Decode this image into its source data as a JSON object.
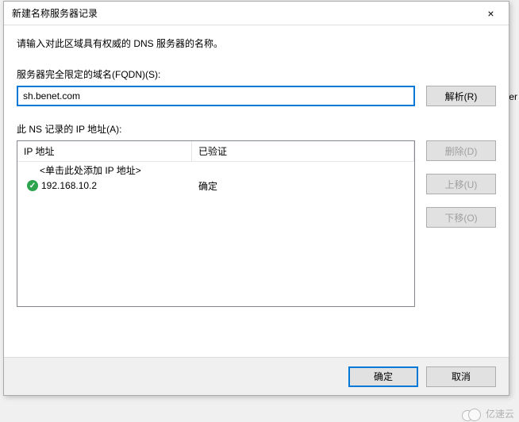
{
  "window": {
    "title": "新建名称服务器记录",
    "close_icon": "×"
  },
  "instruction": "请输入对此区域具有权威的 DNS 服务器的名称。",
  "fqdn": {
    "label": "服务器完全限定的域名(FQDN)(S):",
    "value": "sh.benet.com"
  },
  "resolve_btn": "解析(R)",
  "ip_section": {
    "label": "此 NS 记录的 IP 地址(A):",
    "columns": {
      "ip": "IP 地址",
      "verified": "已验证"
    },
    "placeholder_row": "<单击此处添加 IP 地址>",
    "rows": [
      {
        "ip": "192.168.10.2",
        "verified": "确定",
        "status": "ok"
      }
    ]
  },
  "side_buttons": {
    "delete": "删除(D)",
    "move_up": "上移(U)",
    "move_down": "下移(O)"
  },
  "bottom": {
    "ok": "确定",
    "cancel": "取消"
  },
  "background_text": "aster",
  "watermark": "亿速云"
}
